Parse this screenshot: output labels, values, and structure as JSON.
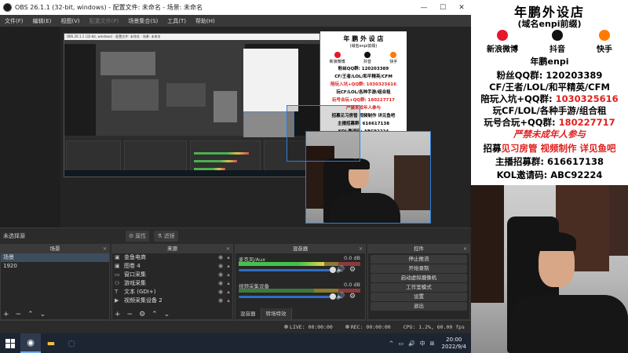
{
  "obs": {
    "window_title": "OBS 26.1.1 (32-bit, windows) - 配置文件: 未命名 - 场景: 未命名",
    "menu": [
      "文件(F)",
      "编辑(E)",
      "视图(V)",
      "配置文件(P)",
      "场景集合(S)",
      "工具(T)",
      "帮助(H)"
    ],
    "nested_title": "OBS 26.1.1 (32-bit, windows) - 配置文件: 未命名 - 场景: 未命名",
    "no_source_selected": "未选择源",
    "properties_label": "属性",
    "filters_label": "滤镜",
    "scenes": {
      "title": "场景",
      "items": [
        "场景",
        "1920"
      ],
      "selected": 0
    },
    "sources": {
      "title": "来源",
      "items": [
        {
          "icon": "image-source-icon",
          "glyph": "▣",
          "name": "金鱼电商"
        },
        {
          "icon": "image-source-icon",
          "glyph": "▣",
          "name": "图卷 4"
        },
        {
          "icon": "window-capture-icon",
          "glyph": "▭",
          "name": "窗口采集"
        },
        {
          "icon": "game-capture-icon",
          "glyph": "⚇",
          "name": "游戏采集"
        },
        {
          "icon": "text-source-icon",
          "glyph": "T",
          "name": "文本 (GDI+)"
        },
        {
          "icon": "video-capture-icon",
          "glyph": "▶",
          "name": "视频采集设备 2"
        }
      ]
    },
    "mixer": {
      "title": "混音器",
      "channels": [
        {
          "name": "麦克风/Aux",
          "db": "0.0 dB",
          "level": 0.7,
          "volume": 0.78
        },
        {
          "name": "视频采集设备",
          "db": "0.0 dB",
          "level": 0.0,
          "volume": 0.78
        }
      ],
      "tabs": [
        "混音器",
        "转场特效"
      ]
    },
    "controls": {
      "title": "控件",
      "buttons": [
        "停止推流",
        "开始录制",
        "启动虚拟摄像机",
        "工作室模式",
        "设置",
        "退出"
      ]
    },
    "status": {
      "live": "LIVE: 00:00:00",
      "rec": "REC: 00:00:00",
      "cpu": "CPU: 1.2%, 60.00 fps"
    },
    "inner_poster": {
      "title": "年 鹏 外 设 店",
      "subtitle": "(域名enpi前缀)",
      "lines": [
        "粉丝QQ群: 120203389",
        "CF/王者/LOL/和平精英/CFM",
        "陪玩入坑+QQ群: 1030325616",
        "玩CF/LOL/各种手游/组合租",
        "玩号合玩+QQ群: 180227717",
        "严禁未成年人参与",
        "招募见习房管 视频制作 详见鱼吧",
        "主播招募群: 616617138",
        "KOL邀请码: ABC92224"
      ]
    }
  },
  "taskbar": {
    "time": "20:00",
    "date": "2022/9/4",
    "tray": [
      "^",
      "▭",
      "🔊",
      "中",
      "⊞"
    ]
  },
  "right_panel": {
    "title": "年鹏外设店",
    "subtitle": "(域名enpi前缀)",
    "platforms": [
      {
        "label": "新浪微博",
        "color": "#e6162d"
      },
      {
        "label": "抖音",
        "color": "#111111"
      },
      {
        "label": "快手",
        "color": "#ff7a00"
      }
    ],
    "handle": "年鹏enpi",
    "fan_group": "粉丝QQ群: 120203389",
    "games": "CF/王者/LOL/和平精英/CFM",
    "entry_label": "陪玩入坑+QQ群:",
    "entry_value": "1030325616",
    "play_line": "玩CF/LOL/各种手游/组合租",
    "account_label": "玩号合玩+QQ群:",
    "account_value": "180227717",
    "minor_notice": "严禁未成年人参与",
    "recruit_prefix": "招募",
    "recruit_red": "见习房管 视频制作 详见鱼吧",
    "streamer_group": "主播招募群: 616617138",
    "kol_code": "KOL邀请码: ABC92224"
  }
}
